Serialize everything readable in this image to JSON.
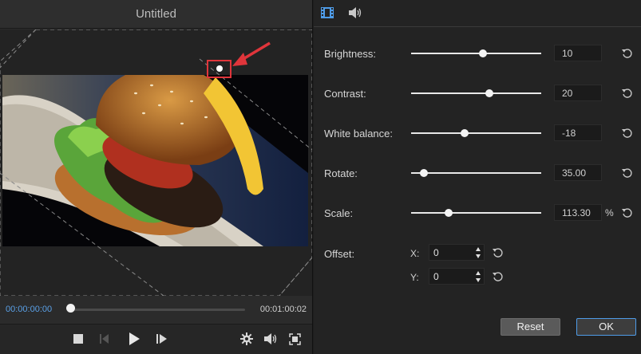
{
  "window": {
    "title": "Untitled"
  },
  "player": {
    "current_time": "00:00:00:00",
    "total_time": "00:01:00:02",
    "progress": 0.0,
    "controls": [
      "stop-icon",
      "prev-frame-icon",
      "play-icon",
      "next-frame-icon",
      "settings-icon",
      "volume-icon",
      "fullscreen-icon"
    ]
  },
  "tabs": [
    {
      "icon": "video-icon",
      "active": true
    },
    {
      "icon": "audio-icon",
      "active": false
    }
  ],
  "adjustments": {
    "brightness": {
      "label": "Brightness:",
      "value": "10",
      "level": 0.55
    },
    "contrast": {
      "label": "Contrast:",
      "value": "20",
      "level": 0.6
    },
    "white_balance": {
      "label": "White balance:",
      "value": "-18",
      "level": 0.41
    },
    "rotate": {
      "label": "Rotate:",
      "value": "35.00",
      "level": 0.1
    },
    "scale": {
      "label": "Scale:",
      "value": "113.30",
      "unit": "%",
      "level": 0.29
    }
  },
  "offset": {
    "label": "Offset:",
    "x": {
      "label": "X:",
      "value": "0"
    },
    "y": {
      "label": "Y:",
      "value": "0"
    }
  },
  "buttons": {
    "reset": "Reset",
    "ok": "OK"
  },
  "colors": {
    "accent": "#4f9ce8",
    "annotation": "#e0353b"
  }
}
